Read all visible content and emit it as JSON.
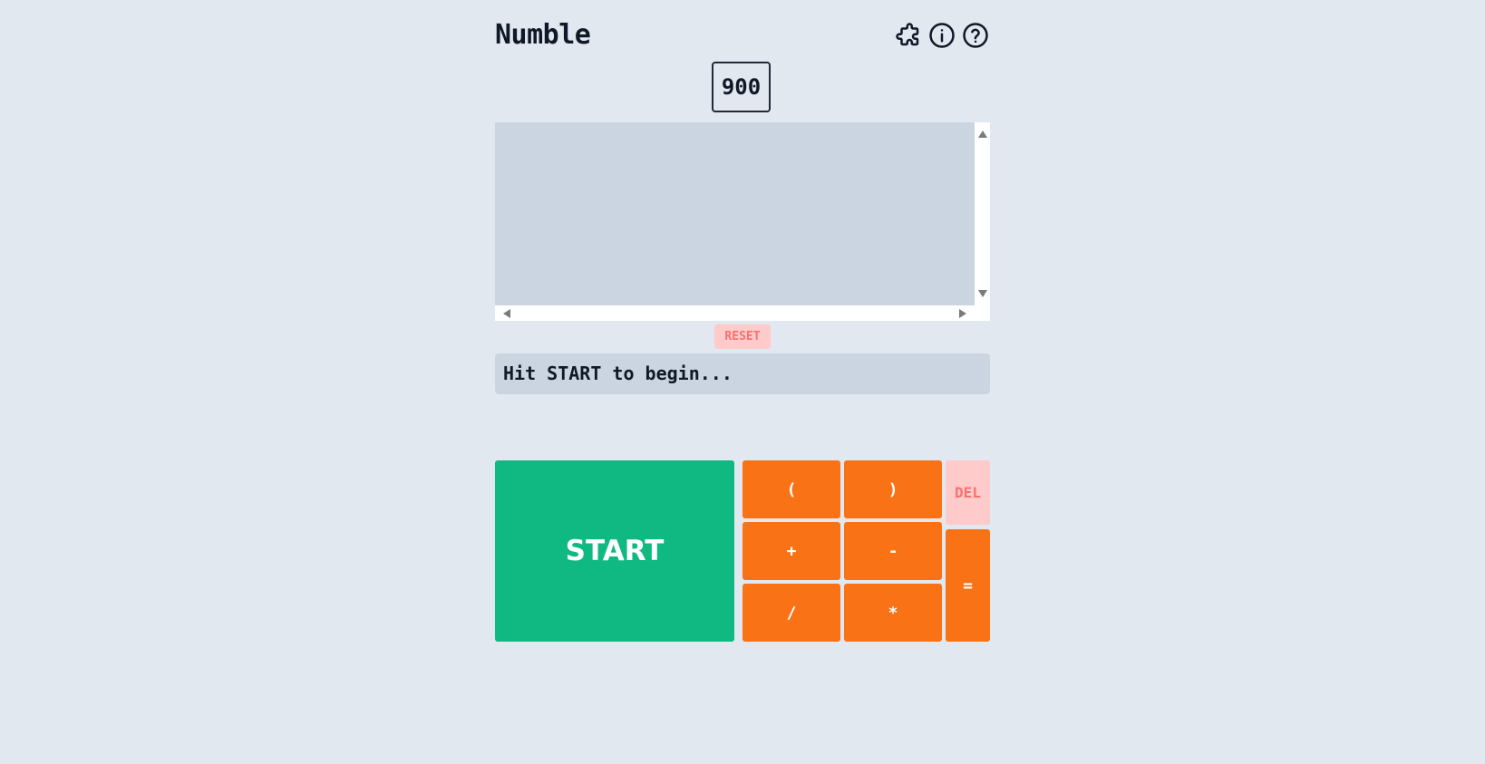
{
  "app": {
    "title": "Numble"
  },
  "header": {
    "icons": [
      "puzzle-icon",
      "info-icon",
      "help-icon"
    ]
  },
  "target": {
    "value": "900"
  },
  "controls": {
    "reset_label": "RESET"
  },
  "status": {
    "message": "Hit START to begin..."
  },
  "keypad": {
    "start_label": "START",
    "open_paren": "(",
    "close_paren": ")",
    "plus": "+",
    "minus": "-",
    "divide": "/",
    "multiply": "*",
    "delete_label": "DEL",
    "equals": "="
  },
  "colors": {
    "background": "#e2e8f0",
    "start": "#10b981",
    "operator": "#f97316",
    "danger_bg": "#fecaca",
    "danger_text": "#f87171",
    "panel": "#cbd5e1"
  }
}
